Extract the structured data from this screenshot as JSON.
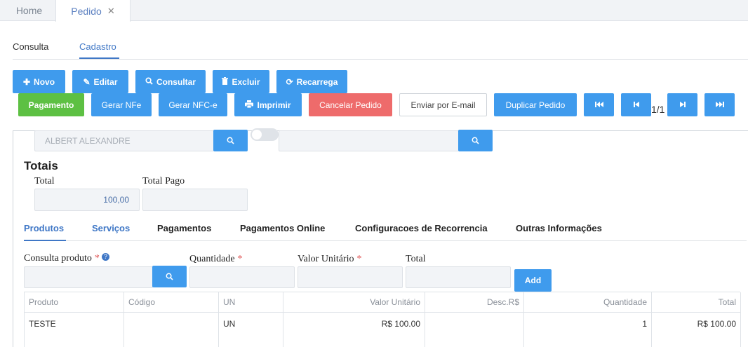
{
  "top_tabs": {
    "home": "Home",
    "pedido": "Pedido",
    "close_glyph": "✕"
  },
  "sub_tabs": {
    "consulta": "Consulta",
    "cadastro": "Cadastro"
  },
  "toolbar1": {
    "novo": "Novo",
    "editar": "Editar",
    "consultar": "Consultar",
    "excluir": "Excluir",
    "recarrega": "Recarrega"
  },
  "toolbar2": {
    "pagamento": "Pagamento",
    "gerar_nfe": "Gerar NFe",
    "gerar_nfce": "Gerar NFC-e",
    "imprimir": "Imprimir",
    "cancelar": "Cancelar Pedido",
    "enviar_email": "Enviar por E-mail",
    "duplicar": "Duplicar Pedido",
    "pager": "1/1"
  },
  "cliente": {
    "value": "ALBERT ALEXANDRE"
  },
  "totais": {
    "title": "Totais",
    "total_label": "Total",
    "total_value": "100,00",
    "total_pago_label": "Total Pago",
    "total_pago_value": ""
  },
  "product_tabs": [
    "Produtos",
    "Serviços",
    "Pagamentos",
    "Pagamentos Online",
    "Configuracoes de Recorrencia",
    "Outras Informações"
  ],
  "product_form": {
    "consulta_label": "Consulta produto",
    "quantidade_label": "Quantidade",
    "valor_label": "Valor Unitário",
    "total_label": "Total",
    "add": "Add",
    "required_mark": "*"
  },
  "table": {
    "headers": [
      "Produto",
      "Código",
      "UN",
      "Valor Unitário",
      "Desc.R$",
      "Quantidade",
      "Total"
    ],
    "rows": [
      [
        "TESTE",
        "",
        "UN",
        "R$ 100.00",
        "",
        "1",
        "R$ 100.00"
      ]
    ]
  },
  "colors": {
    "accent": "#3f9bed",
    "green": "#5dc043",
    "red": "#ee6b6b",
    "link": "#3f77c6"
  }
}
